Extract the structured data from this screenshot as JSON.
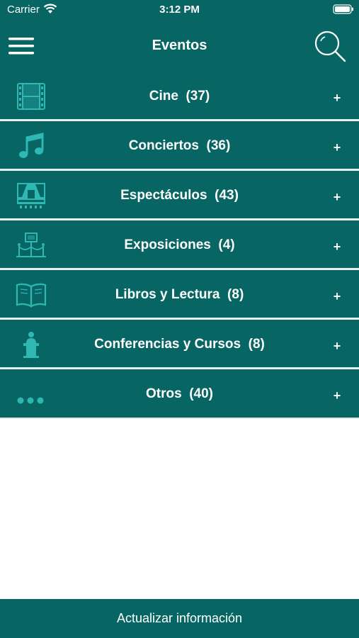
{
  "status_bar": {
    "carrier": "Carrier",
    "time": "3:12 PM"
  },
  "header": {
    "title": "Eventos",
    "menu_icon": "hamburger-menu-icon",
    "search_icon": "search-icon"
  },
  "categories": [
    {
      "label": "Cine  (37)",
      "icon": "film-strip-icon",
      "action": "+"
    },
    {
      "label": "Conciertos  (36)",
      "icon": "music-note-icon",
      "action": "+"
    },
    {
      "label": "Espectáculos  (43)",
      "icon": "theater-stage-icon",
      "action": "+"
    },
    {
      "label": "Exposiciones  (4)",
      "icon": "exhibition-icon",
      "action": "+"
    },
    {
      "label": "Libros y Lectura  (8)",
      "icon": "open-book-icon",
      "action": "+"
    },
    {
      "label": "Conferencias y Cursos  (8)",
      "icon": "lectern-speaker-icon",
      "action": "+"
    },
    {
      "label": "Otros  (40)",
      "icon": "more-dots-icon",
      "action": "+"
    }
  ],
  "footer": {
    "update_label": "Actualizar información"
  },
  "colors": {
    "primary": "#076563",
    "icon": "#2fb8b3",
    "text": "#ffffff",
    "divider": "#e9eff0"
  }
}
